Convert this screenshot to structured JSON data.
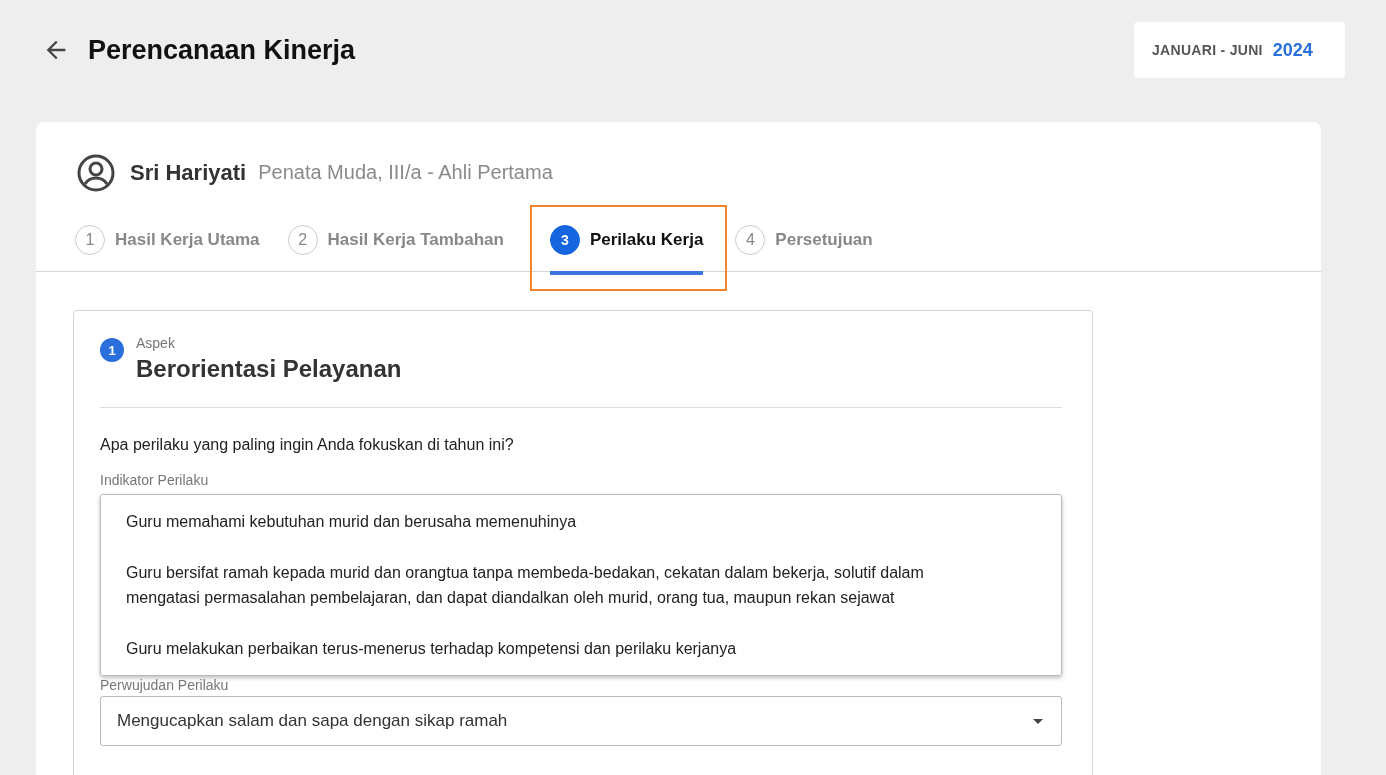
{
  "page": {
    "title": "Perencanaan Kinerja"
  },
  "period": {
    "range": "JANUARI - JUNI",
    "year": "2024"
  },
  "employee": {
    "name": "Sri Hariyati",
    "position": "Penata Muda, III/a - Ahli Pertama"
  },
  "tabs": [
    {
      "number": "1",
      "label": "Hasil Kerja Utama",
      "selected": false,
      "highlighted": false
    },
    {
      "number": "2",
      "label": "Hasil Kerja Tambahan",
      "selected": false,
      "highlighted": false
    },
    {
      "number": "3",
      "label": "Perilaku Kerja",
      "selected": true,
      "highlighted": true
    },
    {
      "number": "4",
      "label": "Persetujuan",
      "selected": false,
      "highlighted": false
    }
  ],
  "aspect": {
    "number": "1",
    "caption": "Aspek",
    "title": "Berorientasi Pelayanan"
  },
  "question": "Apa perilaku yang paling ingin Anda fokuskan di tahun ini?",
  "indicator_field": {
    "label": "Indikator Perilaku",
    "expanded": true,
    "options": [
      "Guru memahami kebutuhan murid dan berusaha memenuhinya",
      "Guru bersifat ramah kepada murid dan orangtua tanpa membeda-bedakan, cekatan dalam bekerja, solutif dalam mengatasi permasalahan pembelajaran, dan dapat diandalkan oleh murid, orang tua, maupun rekan sejawat",
      "Guru melakukan perbaikan terus-menerus terhadap kompetensi dan perilaku kerjanya"
    ]
  },
  "manifestation_field": {
    "label": "Perwujudan Perilaku",
    "value": "Mengucapkan salam dan sapa dengan sikap ramah"
  }
}
